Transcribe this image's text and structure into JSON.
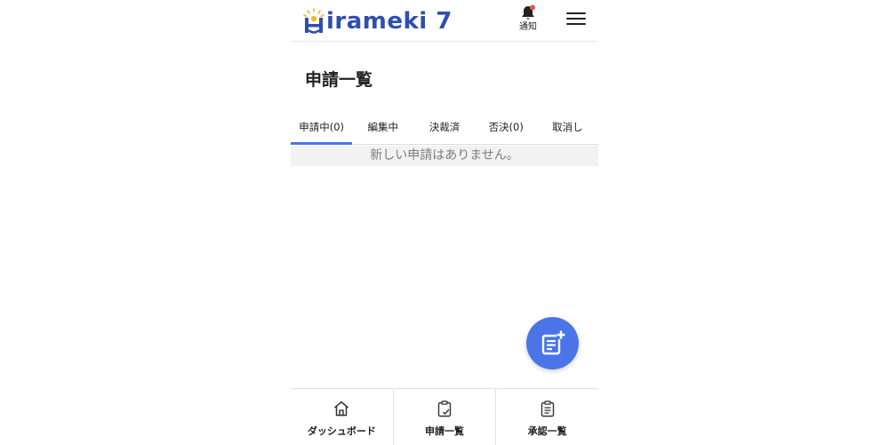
{
  "header": {
    "logo_text": "irameki 7",
    "notification_label": "通知",
    "bell_icon": "bell-icon",
    "menu_icon": "hamburger-menu-icon",
    "notification_dot_color": "#e8543f"
  },
  "page": {
    "title": "申請一覧"
  },
  "tabs": [
    {
      "label": "申請中(0)",
      "active": true
    },
    {
      "label": "編集中",
      "active": false
    },
    {
      "label": "決裁済",
      "active": false
    },
    {
      "label": "否決(0)",
      "active": false
    },
    {
      "label": "取消し",
      "active": false
    }
  ],
  "empty_message": "新しい申請はありません。",
  "fab": {
    "icon": "new-document-icon"
  },
  "bottom_nav": [
    {
      "label": "ダッシュボード",
      "icon": "home-icon"
    },
    {
      "label": "申請一覧",
      "icon": "clipboard-check-icon"
    },
    {
      "label": "承認一覧",
      "icon": "clipboard-list-icon"
    }
  ],
  "colors": {
    "accent": "#4a74e8",
    "logo": "#2e4fb0",
    "logo_sun": "#f2b43a"
  }
}
